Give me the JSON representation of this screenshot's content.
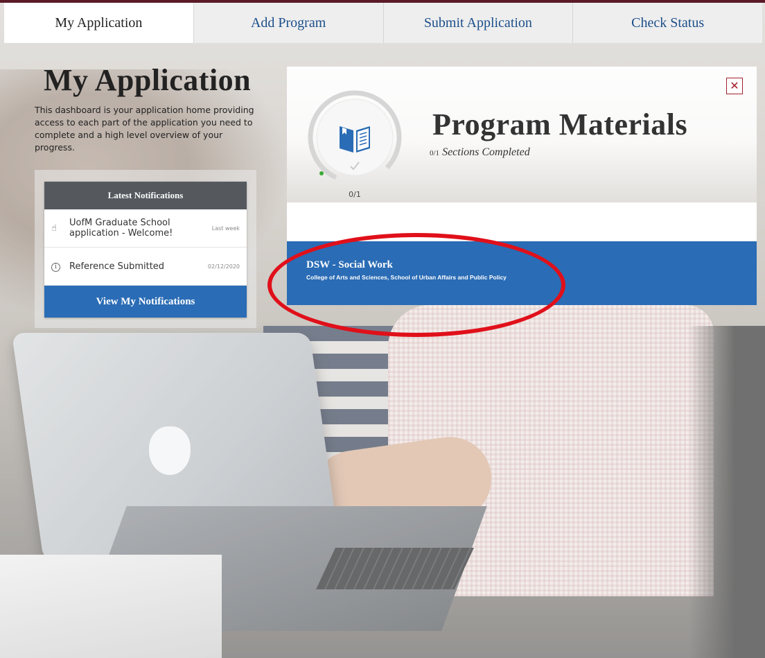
{
  "tabs": [
    {
      "label": "My Application"
    },
    {
      "label": "Add Program"
    },
    {
      "label": "Submit Application"
    },
    {
      "label": "Check Status"
    }
  ],
  "intro": {
    "title": "My Application",
    "description": "This dashboard is your application home providing access to each part of the application you need to complete and a high level overview of your progress."
  },
  "notifications": {
    "header": "Latest Notifications",
    "items": [
      {
        "icon": "hand-wave-icon",
        "text": "UofM Graduate School application - Welcome!",
        "when": "Last week"
      },
      {
        "icon": "info-icon",
        "text": "Reference Submitted",
        "when": "02/12/2020"
      }
    ],
    "button_label": "View My Notifications"
  },
  "program_materials": {
    "title": "Program Materials",
    "progress_fraction": "0/1",
    "progress_text": "Sections Completed",
    "ring_count": "0/1",
    "progress_value": 0,
    "program": {
      "name": "DSW - Social Work",
      "college": "College of Arts and Sciences, School of Urban Affairs and Public Policy"
    }
  },
  "colors": {
    "brand_maroon": "#5a1a28",
    "primary_blue": "#2a6cb5",
    "link_blue": "#1c4e8a",
    "close_red": "#a3202c",
    "annotation_red": "#e0101a"
  }
}
